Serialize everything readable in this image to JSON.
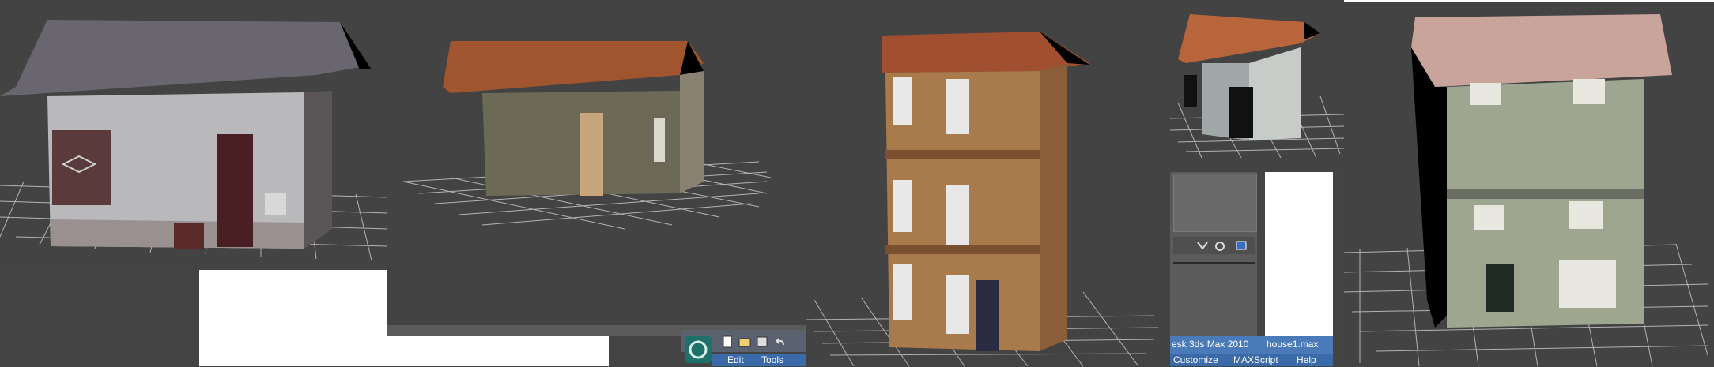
{
  "app": {
    "title_fragment": "esk 3ds Max  2010",
    "file_name": "house1.max"
  },
  "menus": {
    "edit": "Edit",
    "tools": "Tools",
    "customize": "Customize",
    "maxscript": "MAXScript",
    "help": "Help"
  },
  "viewports": [
    {
      "name": "viewport-house-gray-stucco",
      "model": "gray stucco house with dark roof"
    },
    {
      "name": "viewport-house-stone",
      "model": "stone cottage with tiled roof"
    },
    {
      "name": "viewport-house-brick-tower",
      "model": "three-storey brick townhouse"
    },
    {
      "name": "viewport-house-small-plaster",
      "model": "small plaster house with tiled roof"
    },
    {
      "name": "viewport-house-siding",
      "model": "two-storey siding house"
    }
  ],
  "colors": {
    "viewport_bg": "#434343",
    "grid": "#c8c8c8",
    "titlebar": "#4a7ab8",
    "menubar": "#3a6aa8"
  },
  "icons": [
    "3dsmax-logo-icon",
    "new-file-icon",
    "open-file-icon",
    "save-file-icon",
    "undo-icon",
    "select-link-icon",
    "pan-hand-icon",
    "render-setup-icon"
  ]
}
